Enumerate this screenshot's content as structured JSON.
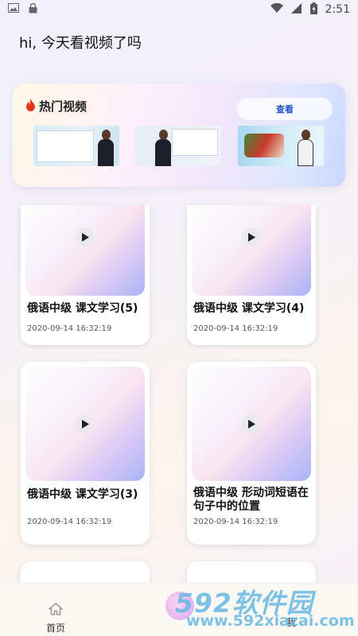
{
  "status_bar": {
    "time": "2:51",
    "icons": [
      "image-icon",
      "lock-icon",
      "wifi-icon",
      "signal-icon",
      "battery-icon"
    ]
  },
  "header": {
    "greeting": "hi, 今天看视频了吗"
  },
  "hot_videos": {
    "title": "热门视频",
    "view_button": "查看",
    "icon": "fire-icon"
  },
  "videos": [
    {
      "title": "俄语中级 课文学习(5)",
      "date": "2020-09-14 16:32:19"
    },
    {
      "title": "俄语中级 课文学习(4)",
      "date": "2020-09-14 16:32:19"
    },
    {
      "title": "俄语中级 课文学习(3)",
      "date": "2020-09-14 16:32:19"
    },
    {
      "title": "俄语中级 形动词短语在句子中的位置",
      "date": "2020-09-14 16:32:19"
    }
  ],
  "bottom_nav": {
    "home_label": "首页",
    "right_label": "我"
  },
  "watermark": {
    "brand": "592软件园",
    "url": "www.592xiazai.com"
  },
  "colors": {
    "accent": "#1f57c8",
    "fire": "#e8331f"
  }
}
